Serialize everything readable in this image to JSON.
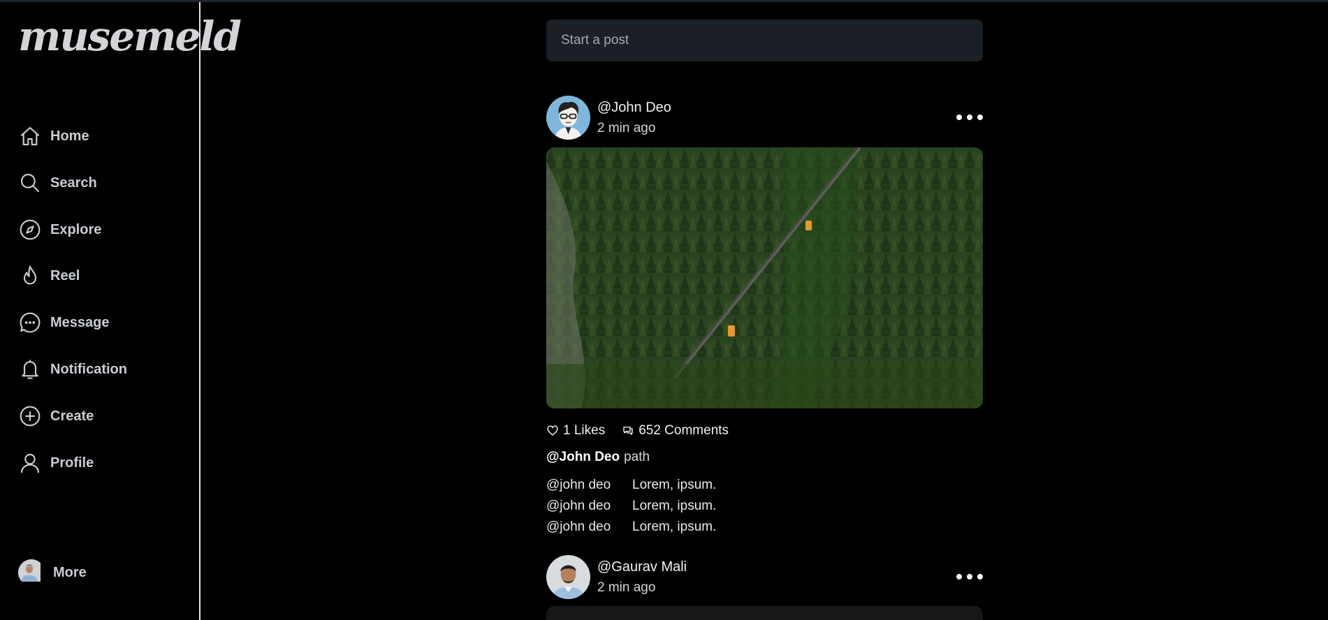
{
  "app": {
    "logo": "musemeld"
  },
  "sidebar": {
    "items": [
      {
        "label": "Home",
        "icon": "home-icon"
      },
      {
        "label": "Search",
        "icon": "search-icon"
      },
      {
        "label": "Explore",
        "icon": "compass-icon"
      },
      {
        "label": "Reel",
        "icon": "flame-icon"
      },
      {
        "label": "Message",
        "icon": "message-icon"
      },
      {
        "label": "Notification",
        "icon": "bell-icon"
      },
      {
        "label": "Create",
        "icon": "plus-circle-icon"
      },
      {
        "label": "Profile",
        "icon": "user-icon"
      }
    ],
    "more_label": "More"
  },
  "composer": {
    "placeholder": "Start a post"
  },
  "posts": [
    {
      "user": "@John Deo",
      "time": "2 min ago",
      "likes": "1 Likes",
      "comments_count": "652 Comments",
      "caption_user": "@John Deo",
      "caption_text": "path",
      "comments": [
        {
          "user": "@john deo",
          "text": "Lorem, ipsum."
        },
        {
          "user": "@john deo",
          "text": "Lorem, ipsum."
        },
        {
          "user": "@john deo",
          "text": "Lorem, ipsum."
        }
      ]
    },
    {
      "user": "@Gaurav Mali",
      "time": "2 min ago"
    }
  ],
  "colors": {
    "background": "#000000",
    "sidebar_text": "#c9cdd3",
    "composer_bg": "#1b2026",
    "avatar_bg": "#7fb7dc"
  }
}
